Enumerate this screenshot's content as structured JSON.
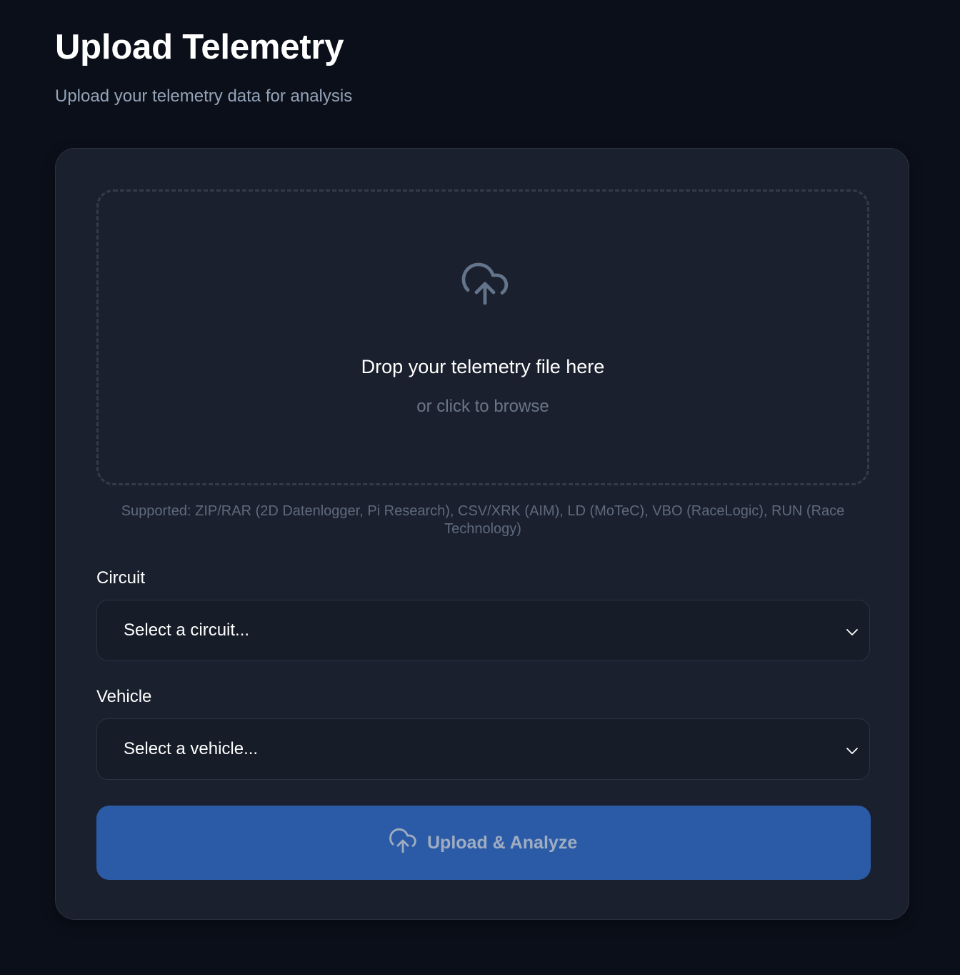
{
  "header": {
    "title": "Upload Telemetry",
    "subtitle": "Upload your telemetry data for analysis"
  },
  "dropzone": {
    "icon": "cloud-upload-icon",
    "title": "Drop your telemetry file here",
    "subtitle": "or click to browse"
  },
  "supported_text": "Supported: ZIP/RAR (2D Datenlogger, Pi Research), CSV/XRK (AIM), LD (MoTeC), VBO (RaceLogic), RUN (Race Technology)",
  "circuit": {
    "label": "Circuit",
    "value": "Select a circuit..."
  },
  "vehicle": {
    "label": "Vehicle",
    "value": "Select a vehicle..."
  },
  "submit": {
    "label": "Upload & Analyze",
    "icon": "cloud-upload-icon"
  },
  "colors": {
    "background": "#0b0f19",
    "card": "#1a202d",
    "accent": "#2b5ba7",
    "muted_text": "#94a3b8"
  }
}
